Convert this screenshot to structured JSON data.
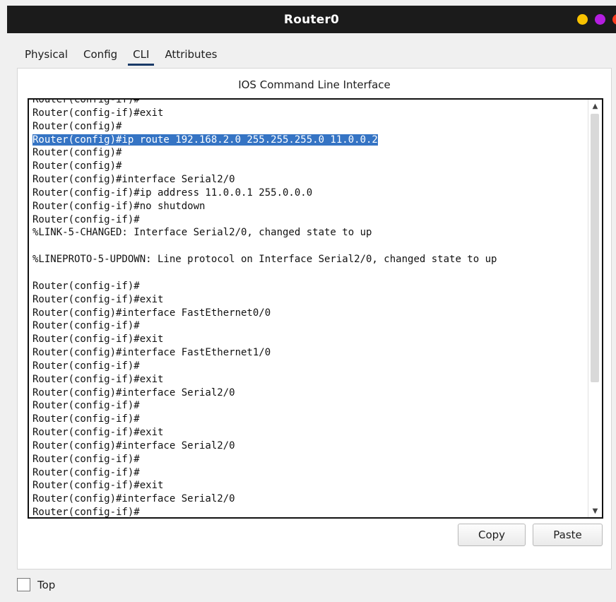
{
  "window": {
    "title": "Router0",
    "controls": [
      {
        "name": "minimize",
        "color": "#f8c200"
      },
      {
        "name": "maximize",
        "color": "#b51ee0"
      },
      {
        "name": "close",
        "color": "#ff3b1e"
      }
    ]
  },
  "tabs": [
    {
      "label": "Physical",
      "active": false
    },
    {
      "label": "Config",
      "active": false
    },
    {
      "label": "CLI",
      "active": true
    },
    {
      "label": "Attributes",
      "active": false
    }
  ],
  "panel": {
    "heading": "IOS Command Line Interface"
  },
  "console": {
    "lines": [
      {
        "text": "Router(config-if)#",
        "highlight": false
      },
      {
        "text": "Router(config-if)#exit",
        "highlight": false
      },
      {
        "text": "Router(config)#",
        "highlight": false
      },
      {
        "text": "Router(config)#ip route 192.168.2.0 255.255.255.0 11.0.0.2",
        "highlight": true
      },
      {
        "text": "Router(config)#",
        "highlight": false
      },
      {
        "text": "Router(config)#",
        "highlight": false
      },
      {
        "text": "Router(config)#interface Serial2/0",
        "highlight": false
      },
      {
        "text": "Router(config-if)#ip address 11.0.0.1 255.0.0.0",
        "highlight": false
      },
      {
        "text": "Router(config-if)#no shutdown",
        "highlight": false
      },
      {
        "text": "Router(config-if)#",
        "highlight": false
      },
      {
        "text": "%LINK-5-CHANGED: Interface Serial2/0, changed state to up",
        "highlight": false
      },
      {
        "text": "",
        "highlight": false
      },
      {
        "text": "%LINEPROTO-5-UPDOWN: Line protocol on Interface Serial2/0, changed state to up",
        "highlight": false
      },
      {
        "text": "",
        "highlight": false
      },
      {
        "text": "Router(config-if)#",
        "highlight": false
      },
      {
        "text": "Router(config-if)#exit",
        "highlight": false
      },
      {
        "text": "Router(config)#interface FastEthernet0/0",
        "highlight": false
      },
      {
        "text": "Router(config-if)#",
        "highlight": false
      },
      {
        "text": "Router(config-if)#exit",
        "highlight": false
      },
      {
        "text": "Router(config)#interface FastEthernet1/0",
        "highlight": false
      },
      {
        "text": "Router(config-if)#",
        "highlight": false
      },
      {
        "text": "Router(config-if)#exit",
        "highlight": false
      },
      {
        "text": "Router(config)#interface Serial2/0",
        "highlight": false
      },
      {
        "text": "Router(config-if)#",
        "highlight": false
      },
      {
        "text": "Router(config-if)#",
        "highlight": false
      },
      {
        "text": "Router(config-if)#exit",
        "highlight": false
      },
      {
        "text": "Router(config)#interface Serial2/0",
        "highlight": false
      },
      {
        "text": "Router(config-if)#",
        "highlight": false
      },
      {
        "text": "Router(config-if)#",
        "highlight": false
      },
      {
        "text": "Router(config-if)#exit",
        "highlight": false
      },
      {
        "text": "Router(config)#interface Serial2/0",
        "highlight": false
      },
      {
        "text": "Router(config-if)#",
        "highlight": false
      }
    ]
  },
  "buttons": {
    "copy": "Copy",
    "paste": "Paste"
  },
  "footer": {
    "top_label": "Top",
    "top_checked": false
  },
  "icons": {
    "scroll_up": "triangle-up",
    "scroll_down": "triangle-down"
  }
}
